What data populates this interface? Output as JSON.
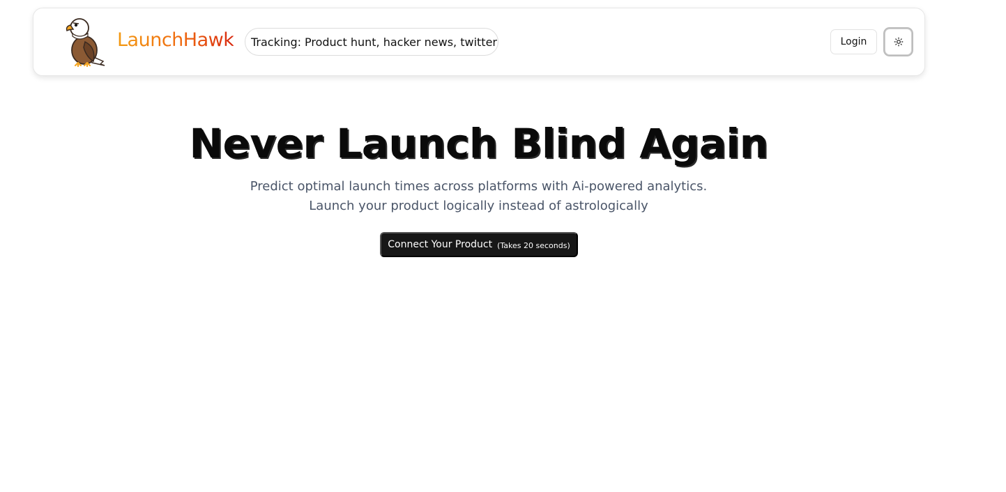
{
  "navbar": {
    "brand": "LaunchHawk",
    "tracking_label": "Tracking:",
    "tracking_value": "Product hunt, hacker news, twitter",
    "login_label": "Login",
    "theme_icon": "sun-icon",
    "logo_icon": "eagle-logo"
  },
  "hero": {
    "title": "Never Launch Blind Again",
    "subtitle_line1": "Predict optimal launch times across platforms with Ai-powered analytics.",
    "subtitle_line2": "Launch your product logically instead of astrologically",
    "cta_label": "Connect Your Product",
    "cta_note": "(Takes 20 seconds)"
  },
  "colors": {
    "brand_gradient_start": "#f39a12",
    "brand_gradient_end": "#d8280e",
    "subtitle": "#4a5568",
    "cta_background": "#171717"
  }
}
